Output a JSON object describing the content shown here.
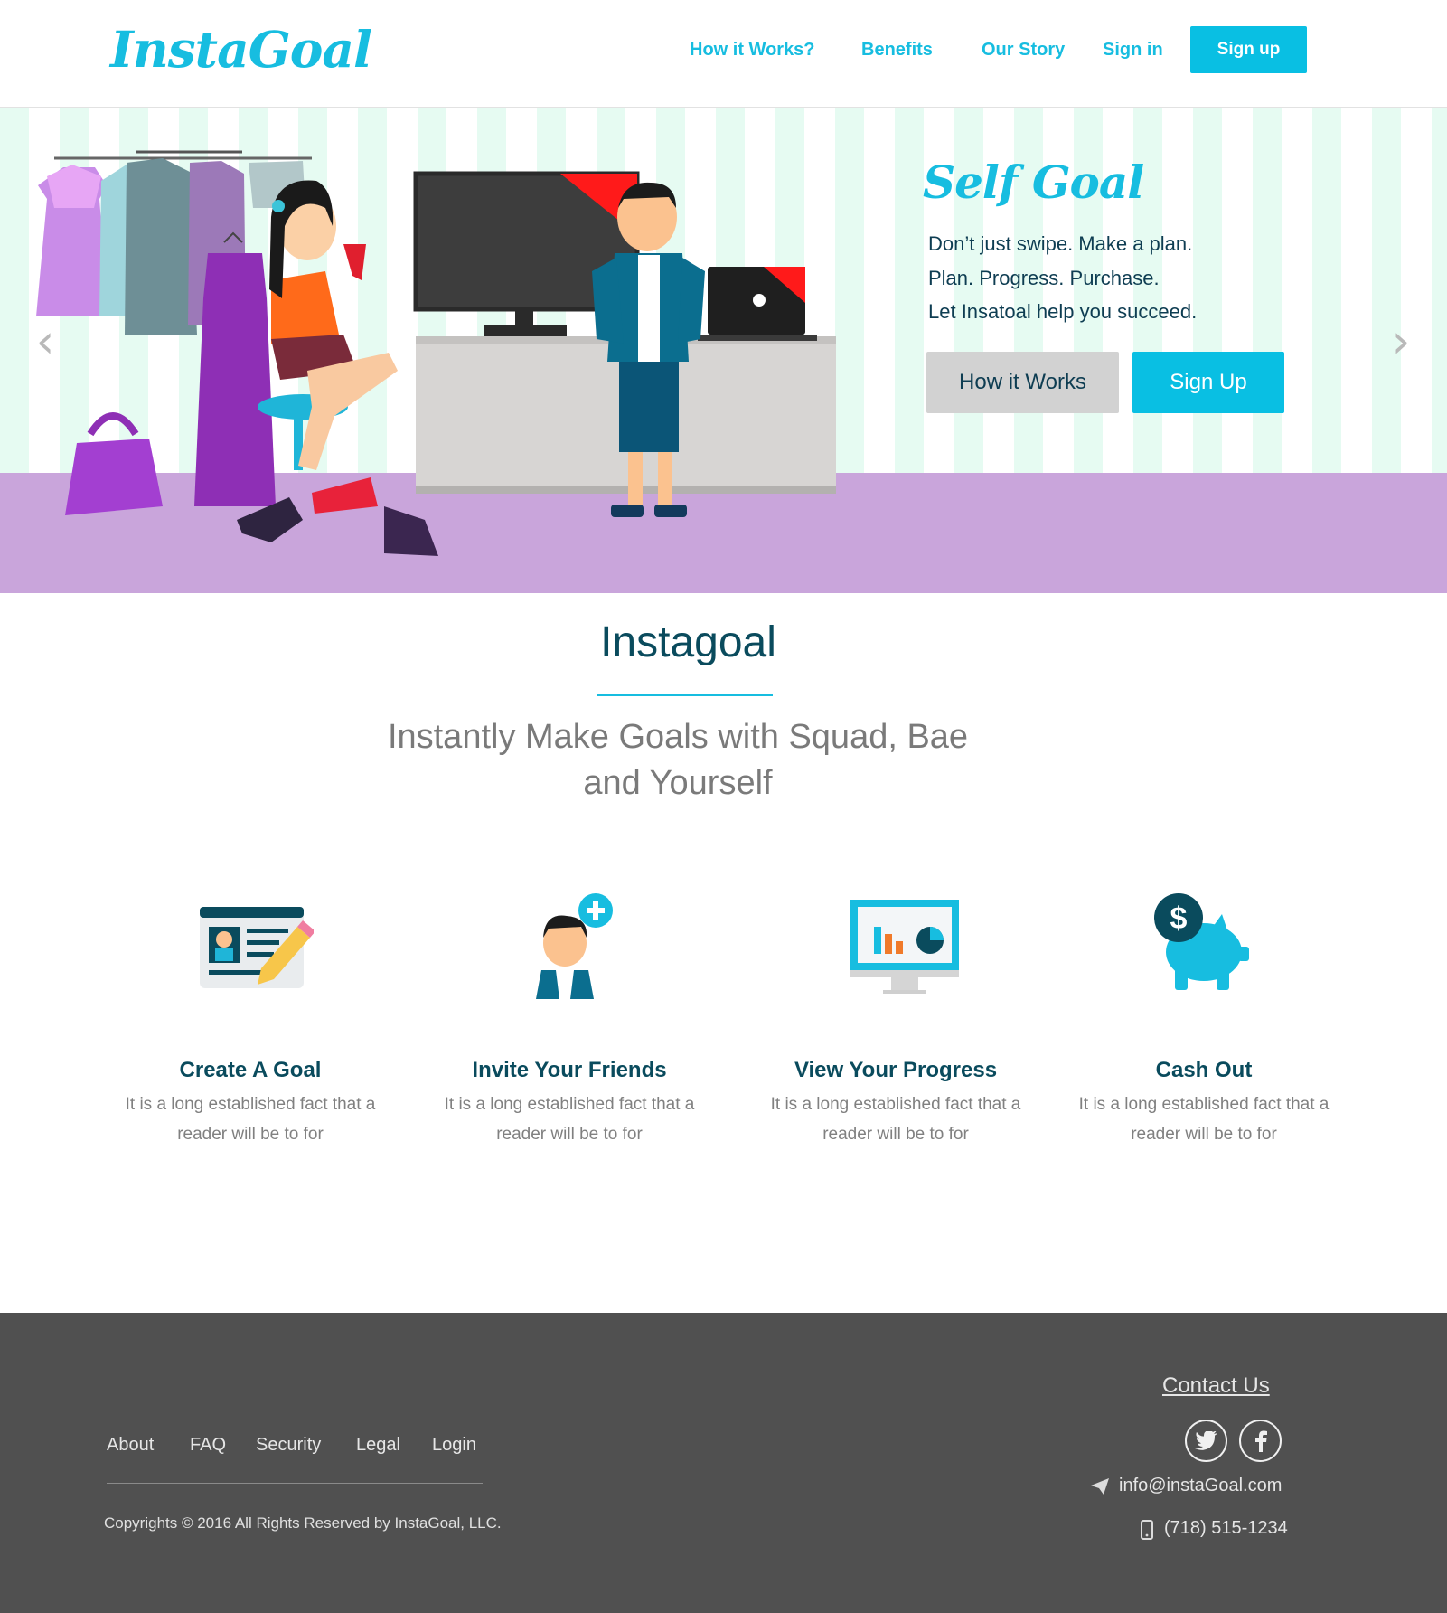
{
  "brand": {
    "logo": "InstaGoal",
    "accent": "#17bde0",
    "dark": "#0a4b5d"
  },
  "nav": {
    "how_it_works": "How it Works?",
    "benefits": "Benefits",
    "our_story": "Our Story",
    "sign_in": "Sign in",
    "sign_up": "Sign up"
  },
  "hero": {
    "title": "Self Goal",
    "lines": [
      "Don’t just swipe. Make a plan.",
      "Plan. Progress. Purchase.",
      "Let Insatoal help you succeed."
    ],
    "btn_how": "How it Works",
    "btn_signup": "Sign Up",
    "prev_icon": "chevron-left-icon",
    "next_icon": "chevron-right-icon"
  },
  "intro": {
    "title": "Instagoal",
    "subtitle": "Instantly Make Goals with Squad, Bae and Yourself"
  },
  "features": [
    {
      "title": "Create A Goal",
      "desc": "It is a long established fact that a reader will be to for",
      "icon": "id-card-pencil-icon"
    },
    {
      "title": "Invite Your Friends",
      "desc": "It is a long established fact that a reader will be to for",
      "icon": "add-user-icon"
    },
    {
      "title": "View Your Progress",
      "desc": "It is a long established fact that a reader will be to for",
      "icon": "monitor-chart-icon"
    },
    {
      "title": "Cash Out",
      "desc": "It is a long established fact that a reader will be to for",
      "icon": "piggy-bank-icon"
    }
  ],
  "footer": {
    "links": [
      "About",
      "FAQ",
      "Security",
      "Legal",
      "Login"
    ],
    "copyright": "Copyrights © 2016 All Rights Reserved by InstaGoal, LLC.",
    "contact_title": "Contact Us",
    "email": "info@instaGoal.com",
    "phone": "(718) 515-1234",
    "social_icons": [
      "twitter-icon",
      "facebook-icon"
    ]
  }
}
